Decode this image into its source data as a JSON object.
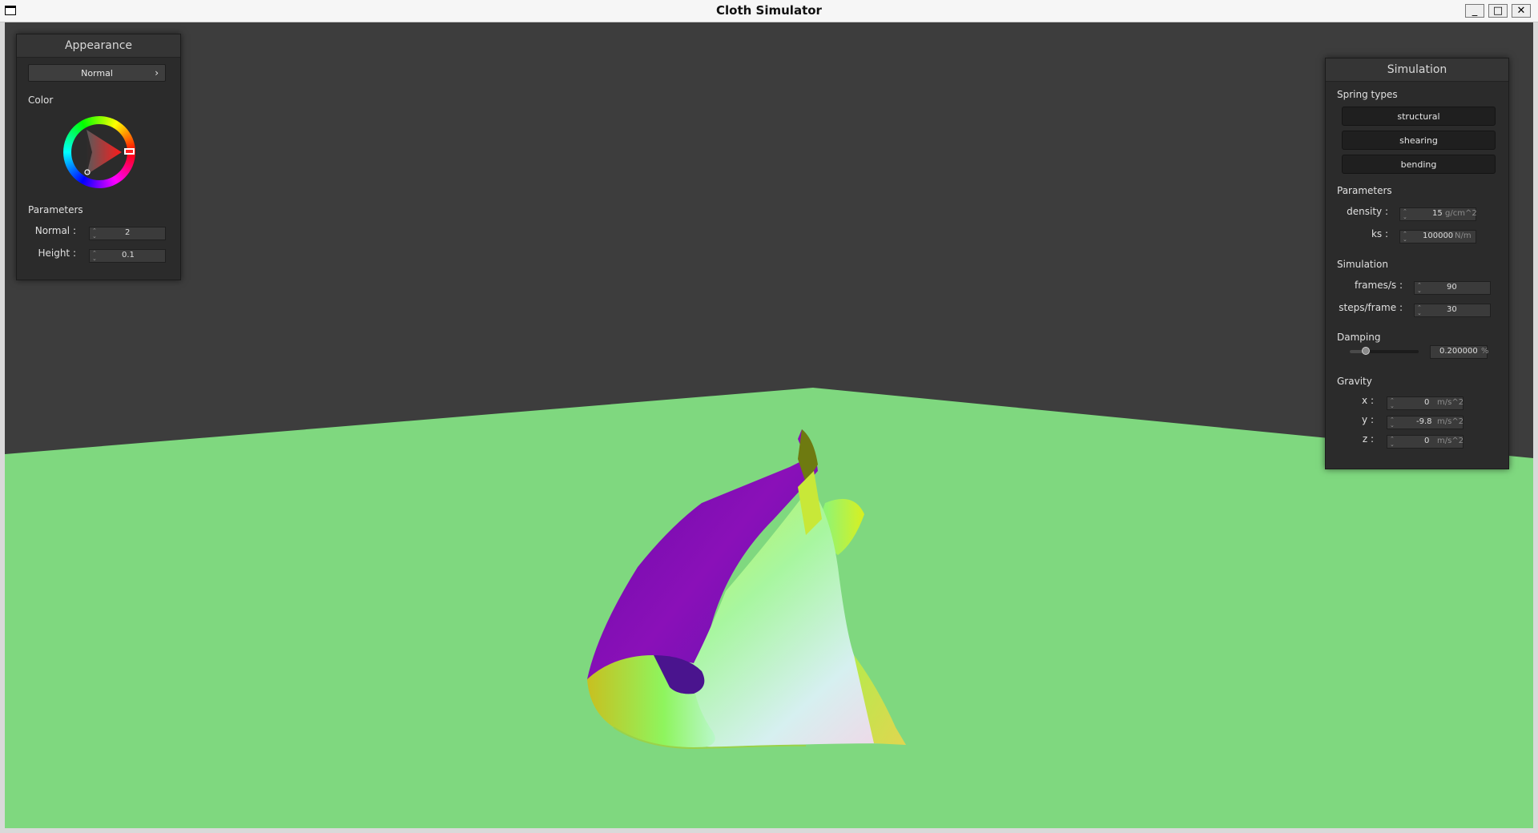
{
  "window": {
    "title": "Cloth Simulator",
    "controls": {
      "minimize": "_",
      "maximize": "□",
      "close": "✕"
    }
  },
  "scene": {
    "background_color": "#3d3d3d",
    "floor_color": "#7fd87f"
  },
  "appearance_panel": {
    "title": "Appearance",
    "shader_dropdown": {
      "value": "Normal",
      "chevron": "›"
    },
    "color_label": "Color",
    "selected_color": "#ff0000",
    "parameters_label": "Parameters",
    "fields": [
      {
        "label": "Normal :",
        "value": "2"
      },
      {
        "label": "Height :",
        "value": "0.1"
      }
    ]
  },
  "simulation_panel": {
    "title": "Simulation",
    "spring_types_label": "Spring types",
    "spring_buttons": [
      "structural",
      "shearing",
      "bending"
    ],
    "parameters_label": "Parameters",
    "parameters": [
      {
        "label": "density :",
        "value": "15",
        "unit": "g/cm^2"
      },
      {
        "label": "ks :",
        "value": "100000",
        "unit": "N/m"
      }
    ],
    "simulation_label": "Simulation",
    "simulation_fields": [
      {
        "label": "frames/s :",
        "value": "90"
      },
      {
        "label": "steps/frame :",
        "value": "30"
      }
    ],
    "damping_label": "Damping",
    "damping": {
      "fraction": 0.2,
      "value": "0.200000",
      "unit": "%"
    },
    "gravity_label": "Gravity",
    "gravity": [
      {
        "label": "x :",
        "value": "0",
        "unit": "m/s^2"
      },
      {
        "label": "y :",
        "value": "-9.8",
        "unit": "m/s^2"
      },
      {
        "label": "z :",
        "value": "0",
        "unit": "m/s^2"
      }
    ]
  }
}
